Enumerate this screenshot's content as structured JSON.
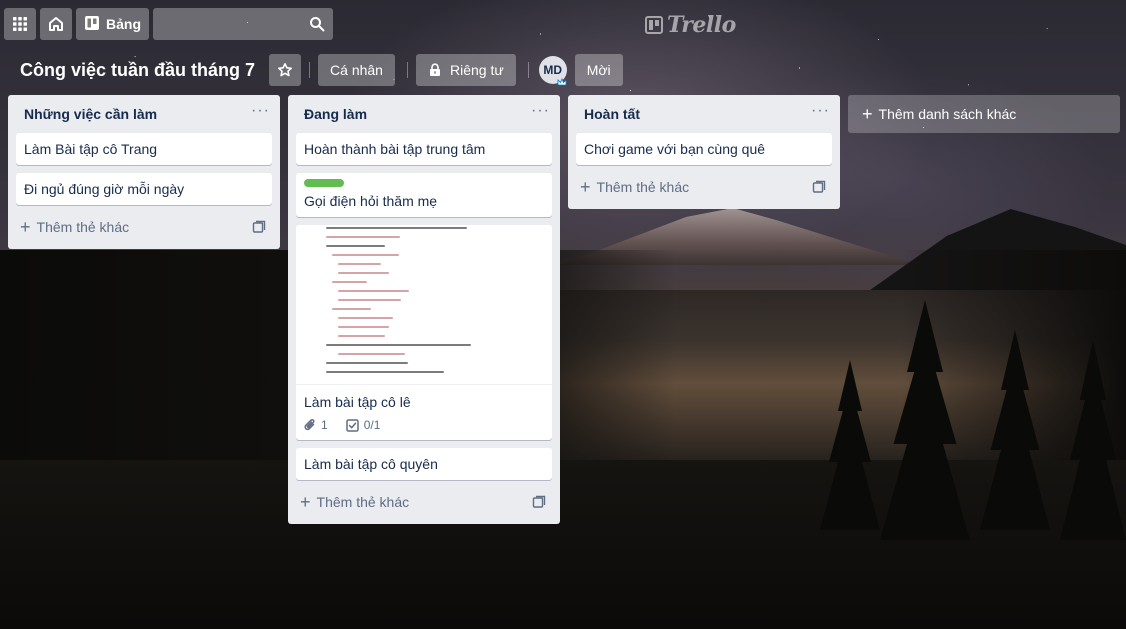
{
  "app": {
    "logo_text": "Trello",
    "boards_button_label": "Bảng",
    "search_placeholder": ""
  },
  "board": {
    "title": "Công việc tuần đầu tháng 7",
    "visibility_team_label": "Cá nhân",
    "visibility_privacy_label": "Riêng tư",
    "member_initials": "MD",
    "invite_label": "Mời"
  },
  "lists": [
    {
      "title": "Những việc cần làm",
      "cards": [
        {
          "text": "Làm Bài tập cô Trang"
        },
        {
          "text": "Đi ngủ đúng giờ mỗi ngày"
        }
      ],
      "add_card_label": "Thêm thẻ khác"
    },
    {
      "title": "Đang làm",
      "cards": [
        {
          "text": "Hoàn thành bài tập trung tâm"
        },
        {
          "text": "Gọi điện hỏi thăm mẹ",
          "label_color": "#61bd4f"
        },
        {
          "text": "Làm bài tập cô lê",
          "attachments": "1",
          "checklist": "0/1"
        },
        {
          "text": "Làm bài tập cô quyên"
        }
      ],
      "add_card_label": "Thêm thẻ khác"
    },
    {
      "title": "Hoàn tất",
      "cards": [
        {
          "text": "Chơi game với bạn cùng quê"
        }
      ],
      "add_card_label": "Thêm thẻ khác"
    }
  ],
  "add_list_label": "Thêm danh sách khác",
  "colors": {
    "list_bg": "#ebecf0",
    "card_text": "#172b4d",
    "label_green": "#61bd4f"
  },
  "icons": [
    "apps-grid-icon",
    "home-icon",
    "board-icon",
    "search-icon",
    "star-icon",
    "lock-icon",
    "crown-icon",
    "more-horizontal-icon",
    "plus-icon",
    "template-icon",
    "attachment-icon",
    "checklist-icon"
  ]
}
